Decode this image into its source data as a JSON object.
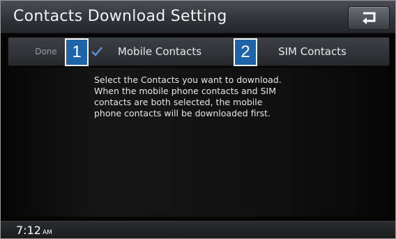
{
  "header": {
    "title": "Contacts Download Setting",
    "back_icon": "return-arrow-icon"
  },
  "tabs": {
    "done_label": "Done",
    "mobile_label": "Mobile Contacts",
    "sim_label": "SIM Contacts",
    "check_icon": "checkmark-icon"
  },
  "callouts": [
    "1",
    "2"
  ],
  "message": {
    "lines": [
      "Select the Contacts you want to download.",
      "When the mobile phone contacts and SIM",
      "contacts are both selected, the mobile",
      "phone contacts will be downloaded first."
    ]
  },
  "status": {
    "time": "7:12",
    "ampm": "AM"
  },
  "colors": {
    "callout_blue": "#1f63a8",
    "check_blue": "#5b8fd6"
  }
}
